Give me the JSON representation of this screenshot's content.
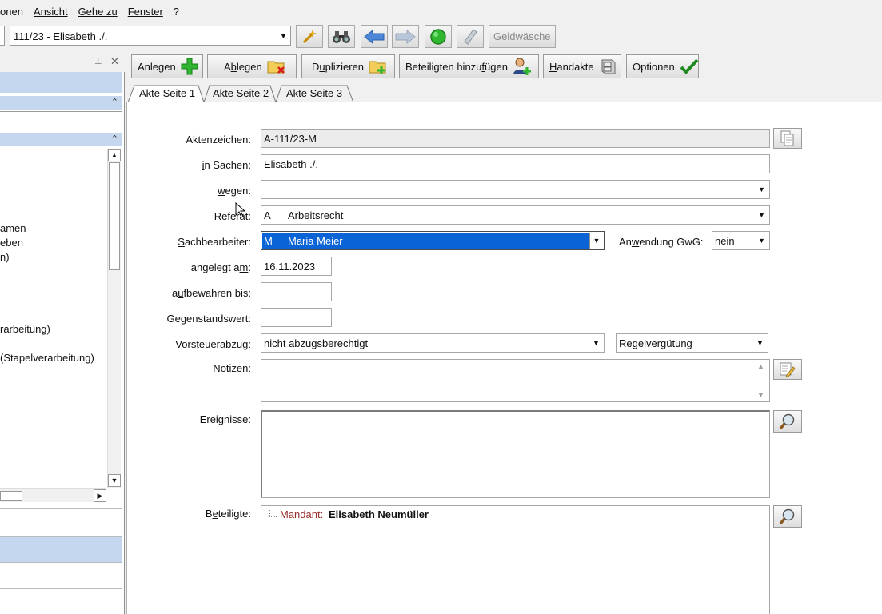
{
  "menu": [
    {
      "label": "onen"
    },
    {
      "label": "Ansicht"
    },
    {
      "label": "Gehe zu"
    },
    {
      "label": "Fenster"
    },
    {
      "label": "?"
    }
  ],
  "toolbar": {
    "case_combo_value": "111/23  -  Elisabeth ./.",
    "geldwaesche_label": "Geldwäsche"
  },
  "left_panel": {
    "items": [
      {
        "text": "amen"
      },
      {
        "text": "eben"
      },
      {
        "text": "n)"
      },
      {
        "text": "rarbeitung)"
      },
      {
        "text": "(Stapelverarbeitung)"
      }
    ]
  },
  "actions": {
    "anlegen": "Anlegen",
    "ablegen": "Ablegen",
    "duplizieren": "Duplizieren",
    "beteiligten": "Beteiligten hinzufügen",
    "handakte": "Handakte",
    "optionen": "Optionen"
  },
  "tabs": [
    {
      "label": "Akte Seite 1"
    },
    {
      "label": "Akte Seite 2"
    },
    {
      "label": "Akte Seite 3"
    }
  ],
  "form": {
    "aktenzeichen_label": "Aktenzeichen:",
    "aktenzeichen_value": "A-111/23-M",
    "insachen_label": "in Sachen:",
    "insachen_value": "Elisabeth ./.",
    "wegen_label": "wegen:",
    "wegen_value": "",
    "referat_label": "Referat:",
    "referat_code": "A",
    "referat_value": "Arbeitsrecht",
    "sachbearbeiter_label": "Sachbearbeiter:",
    "sachbearbeiter_code": "M",
    "sachbearbeiter_value": "Maria Meier",
    "gwg_label": "Anwendung GwG:",
    "gwg_value": "nein",
    "angelegt_label": "angelegt am:",
    "angelegt_value": "16.11.2023",
    "aufbewahren_label": "aufbewahren bis:",
    "aufbewahren_value": "",
    "gegenstandswert_label": "Gegenstandswert:",
    "gegenstandswert_value": "",
    "vorsteuer_label": "Vorsteuerabzug:",
    "vorsteuer_value": "nicht abzugsberechtigt",
    "verguetung_value": "Regelvergütung",
    "notizen_label": "Notizen:",
    "ereignisse_label": "Ereignisse:",
    "beteiligte_label": "Beteiligte:",
    "beteiligte_role": "Mandant:",
    "beteiligte_name": "Elisabeth Neumüller"
  }
}
